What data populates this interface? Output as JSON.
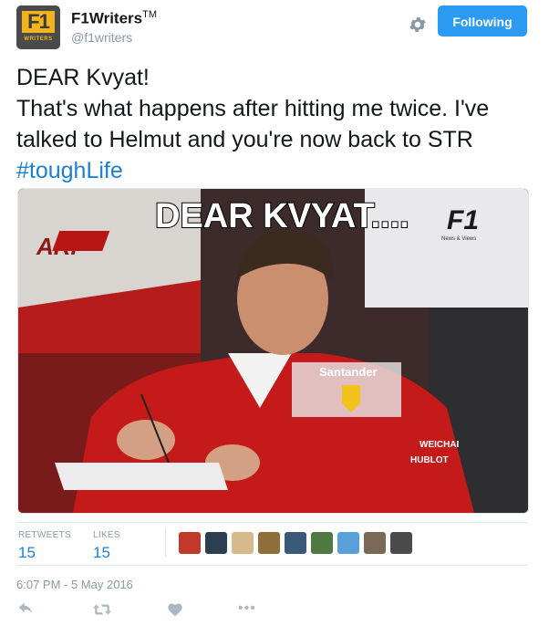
{
  "user": {
    "avatar_top": "F1",
    "avatar_bottom": "WRITERS",
    "name": "F1Writers",
    "trademark": "TM",
    "handle": "@f1writers"
  },
  "header": {
    "gear_icon": "gear-icon",
    "follow_label": "Following"
  },
  "tweet": {
    "lines": [
      "DEAR Kvyat!",
      "That's what happens after hitting me twice. I've",
      "talked to Helmut and you're now back to STR"
    ],
    "hashtag": "#toughLife"
  },
  "media": {
    "caption": "DEAR KVYAT....",
    "logo_text": "F1",
    "logo_sub": "News & Views",
    "left_text": "ARI",
    "chest_texts": [
      "Santander",
      "WEICHAI",
      "HUBLOT"
    ]
  },
  "stats": {
    "retweets_label": "RETWEETS",
    "retweets_value": "15",
    "likes_label": "LIKES",
    "likes_value": "15",
    "liker_colors": [
      "#c0392b",
      "#2c3e50",
      "#d6b98c",
      "#8e6e3b",
      "#3a5a78",
      "#4f7a3f",
      "#5aa0d8",
      "#7a6a55",
      "#4a4a4a"
    ]
  },
  "timestamp": "6:07 PM - 5 May 2016",
  "actions": [
    "reply-icon",
    "retweet-icon",
    "like-icon",
    "more-icon"
  ]
}
